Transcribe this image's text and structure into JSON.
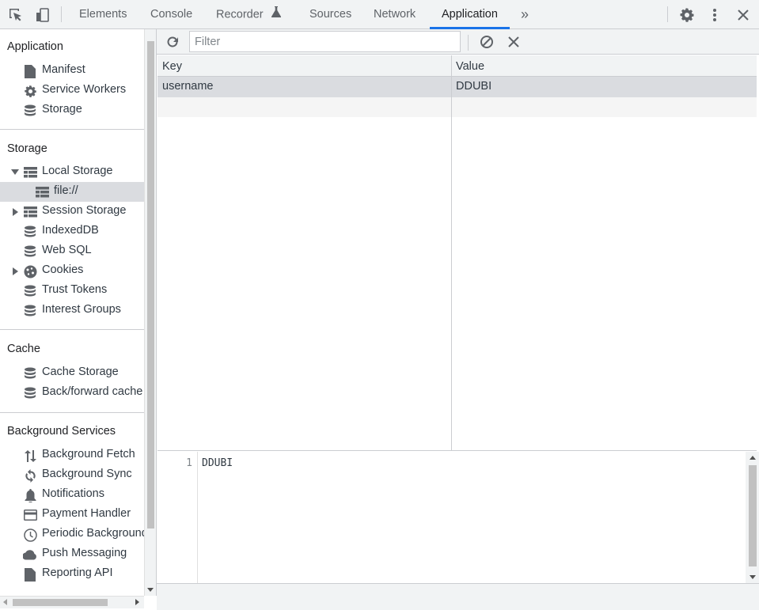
{
  "toolbar": {
    "inspect_icon": "inspect-element-icon",
    "device_icon": "device-toolbar-icon",
    "tabs": [
      {
        "label": "Elements",
        "active": false
      },
      {
        "label": "Console",
        "active": false
      },
      {
        "label": "Recorder",
        "active": false,
        "icon": "flask-icon"
      },
      {
        "label": "Sources",
        "active": false
      },
      {
        "label": "Network",
        "active": false
      },
      {
        "label": "Application",
        "active": true
      }
    ],
    "more_tabs_glyph": "»",
    "right_icons": [
      "gear-icon",
      "kebab-menu-icon",
      "close-icon"
    ]
  },
  "sidebar": {
    "sections": [
      {
        "title": "Application",
        "items": [
          {
            "label": "Manifest",
            "icon": "document-icon"
          },
          {
            "label": "Service Workers",
            "icon": "gear-icon"
          },
          {
            "label": "Storage",
            "icon": "database-icon"
          }
        ]
      },
      {
        "title": "Storage",
        "items": [
          {
            "label": "Local Storage",
            "icon": "table-icon",
            "expanded": true
          },
          {
            "label": "file://",
            "icon": "table-icon",
            "selected": true,
            "child": true
          },
          {
            "label": "Session Storage",
            "icon": "table-icon",
            "expanded": false
          },
          {
            "label": "IndexedDB",
            "icon": "database-icon"
          },
          {
            "label": "Web SQL",
            "icon": "database-icon"
          },
          {
            "label": "Cookies",
            "icon": "cookie-icon",
            "expanded": false
          },
          {
            "label": "Trust Tokens",
            "icon": "database-icon"
          },
          {
            "label": "Interest Groups",
            "icon": "database-icon"
          }
        ]
      },
      {
        "title": "Cache",
        "items": [
          {
            "label": "Cache Storage",
            "icon": "database-icon"
          },
          {
            "label": "Back/forward cache",
            "icon": "database-icon"
          }
        ]
      },
      {
        "title": "Background Services",
        "items": [
          {
            "label": "Background Fetch",
            "icon": "up-down-arrows-icon"
          },
          {
            "label": "Background Sync",
            "icon": "sync-icon"
          },
          {
            "label": "Notifications",
            "icon": "bell-icon"
          },
          {
            "label": "Payment Handler",
            "icon": "credit-card-icon"
          },
          {
            "label": "Periodic Background Sync",
            "icon": "clock-icon"
          },
          {
            "label": "Push Messaging",
            "icon": "cloud-icon"
          },
          {
            "label": "Reporting API",
            "icon": "document-icon"
          }
        ]
      }
    ]
  },
  "main": {
    "filter": {
      "placeholder": "Filter",
      "value": ""
    },
    "table": {
      "columns": [
        "Key",
        "Value"
      ],
      "rows": [
        {
          "key": "username",
          "value": "DDUBI",
          "selected": true
        }
      ]
    },
    "preview": {
      "line_numbers": [
        "1"
      ],
      "lines": [
        "DDUBI"
      ]
    }
  }
}
